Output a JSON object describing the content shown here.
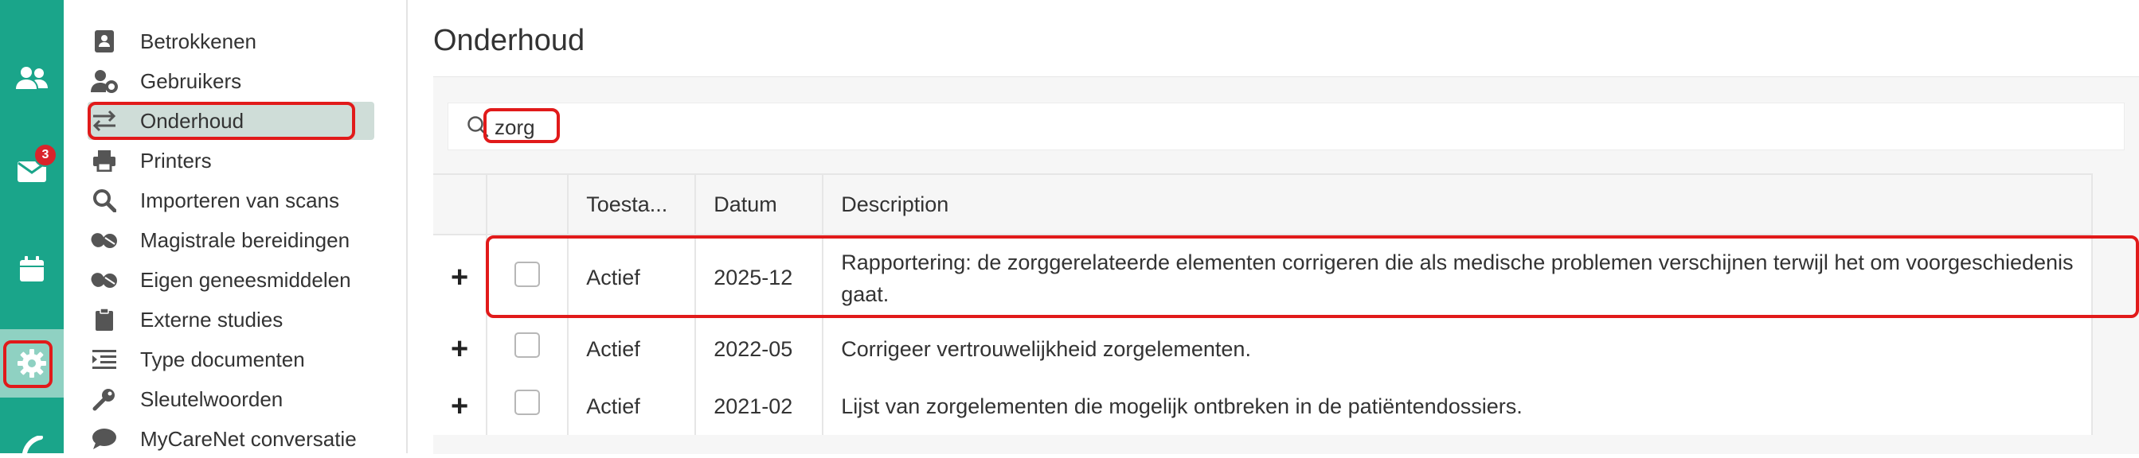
{
  "rail": {
    "badge_count": "3",
    "items": [
      {
        "icon": "users-icon"
      },
      {
        "icon": "mail-icon"
      },
      {
        "icon": "calendar-icon"
      },
      {
        "icon": "gear-icon"
      }
    ]
  },
  "sidebar": {
    "items": [
      {
        "label": "Betrokkenen",
        "icon": "contact-card-icon"
      },
      {
        "label": "Gebruikers",
        "icon": "user-gear-icon"
      },
      {
        "label": "Onderhoud",
        "icon": "swap-arrows-icon"
      },
      {
        "label": "Printers",
        "icon": "printer-icon"
      },
      {
        "label": "Importeren van scans",
        "icon": "search-icon"
      },
      {
        "label": "Magistrale bereidingen",
        "icon": "pills-icon"
      },
      {
        "label": "Eigen geneesmiddelen",
        "icon": "pills-icon"
      },
      {
        "label": "Externe studies",
        "icon": "clipboard-icon"
      },
      {
        "label": "Type documenten",
        "icon": "list-indent-icon"
      },
      {
        "label": "Sleutelwoorden",
        "icon": "key-icon"
      },
      {
        "label": "MyCareNet conversatie",
        "icon": "speech-bubble-icon"
      }
    ]
  },
  "main": {
    "title": "Onderhoud",
    "search": {
      "value": "zorg"
    },
    "table": {
      "headers": [
        "Toesta...",
        "Datum",
        "Description"
      ],
      "rows": [
        {
          "status": "Actief",
          "date": "2025-12",
          "description_line1": "Rapportering: de zorggerelateerde elementen corrigeren die als medische problemen verschijnen terwijl het om voorgeschiedenis",
          "description_line2": "gaat."
        },
        {
          "status": "Actief",
          "date": "2022-05",
          "description": "Corrigeer vertrouwelijkheid zorgelementen."
        },
        {
          "status": "Actief",
          "date": "2021-02",
          "description": "Lijst van zorgelementen die mogelijk ontbreken in de patiëntendossiers."
        }
      ]
    }
  },
  "colors": {
    "rail": "#1aa58a",
    "highlight": "#e11a1a",
    "active_item": "#cfddd8"
  }
}
